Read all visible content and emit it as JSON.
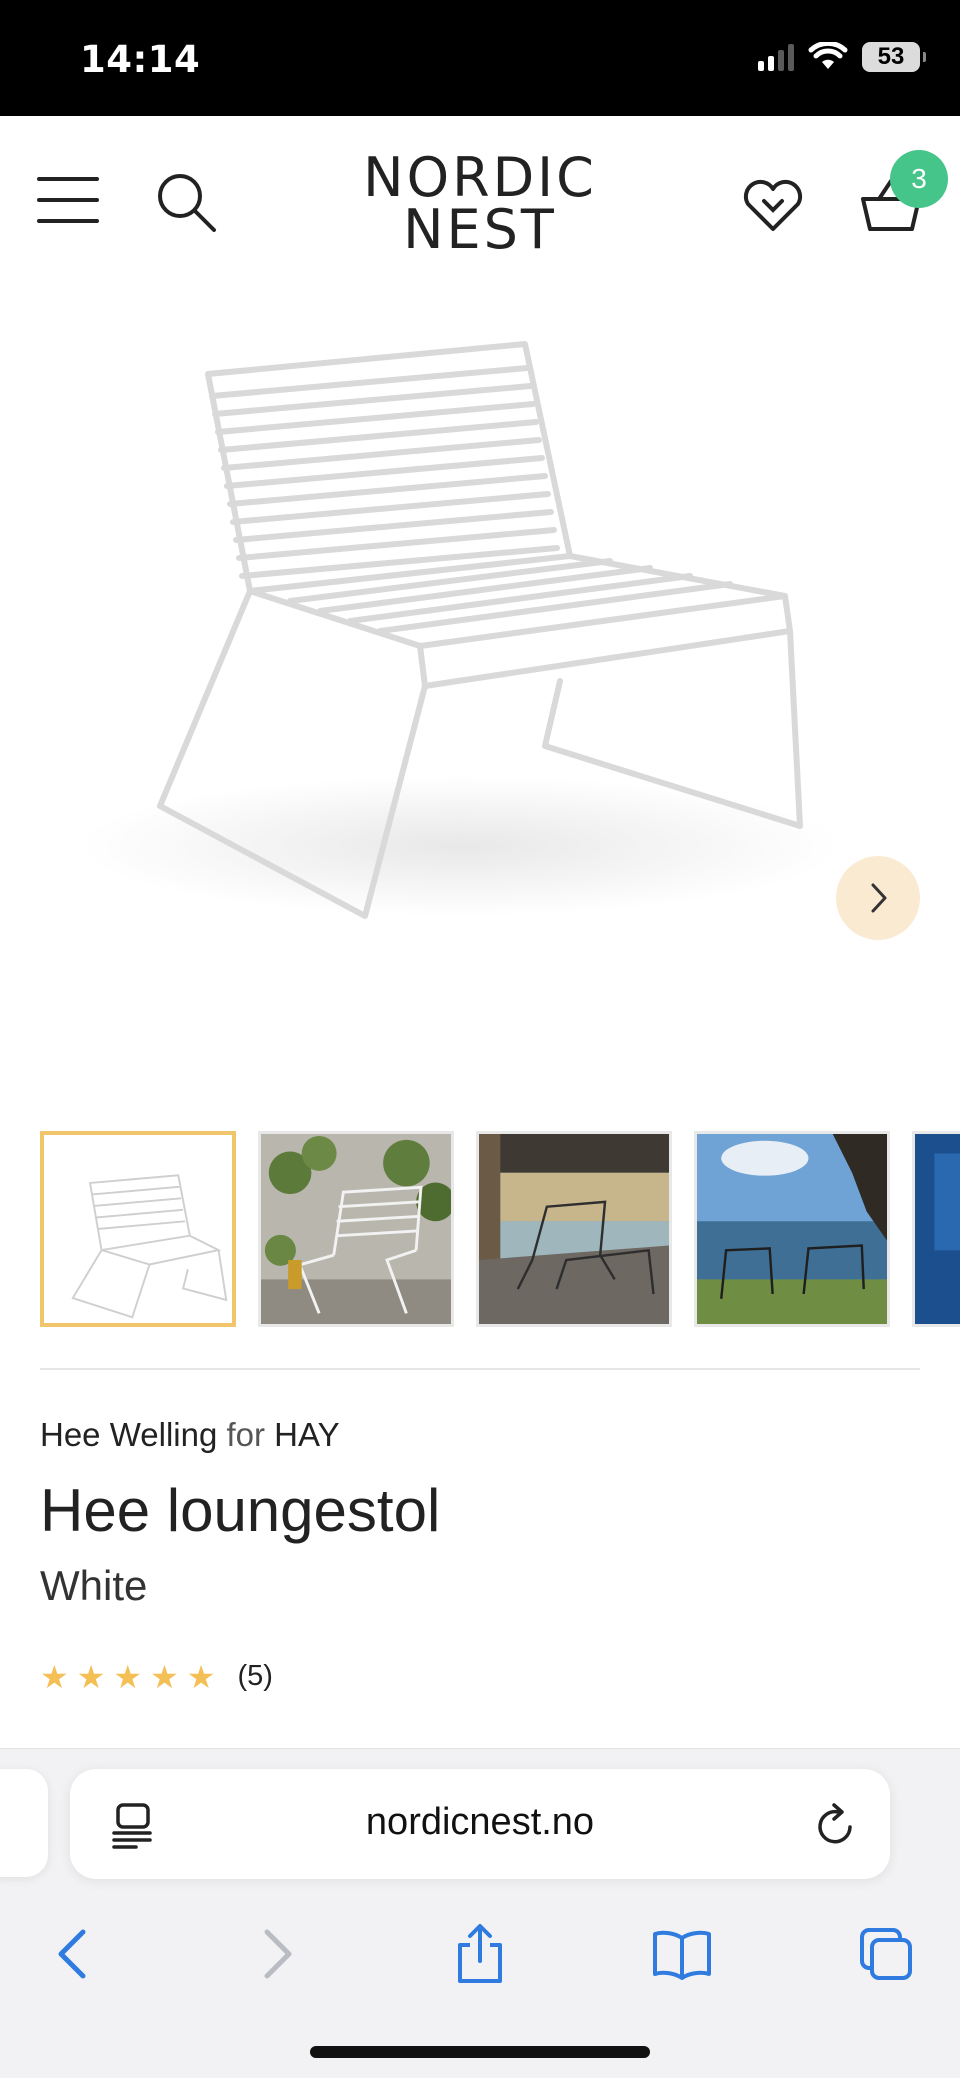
{
  "status_bar": {
    "time": "14:14",
    "battery": "53",
    "icons": [
      "signal-icon",
      "wifi-icon",
      "battery-icon"
    ]
  },
  "header": {
    "logo_line1": "NORDIC",
    "logo_line2": "NEST",
    "cart_count": "3",
    "icons": [
      "menu-icon",
      "search-icon",
      "heart-icon",
      "basket-icon"
    ],
    "accent_color": "#45c58a"
  },
  "gallery": {
    "thumbnail_count": 5,
    "active_index": 0,
    "icons": [
      "chevron-right-icon"
    ],
    "active_border_color": "#f1c56b"
  },
  "product": {
    "designer": "Hee Welling",
    "for_text": "for",
    "brand": "HAY",
    "title": "Hee loungestol",
    "variant": "White",
    "rating_stars": 5,
    "review_count": "(5)",
    "star_color": "#f4bf55"
  },
  "browser": {
    "url": "nordicnest.no",
    "icons": [
      "reader-icon",
      "reload-icon",
      "back-icon",
      "forward-icon",
      "share-icon",
      "bookmarks-icon",
      "tabs-icon"
    ],
    "toolbar_color": "#2f7be0"
  }
}
